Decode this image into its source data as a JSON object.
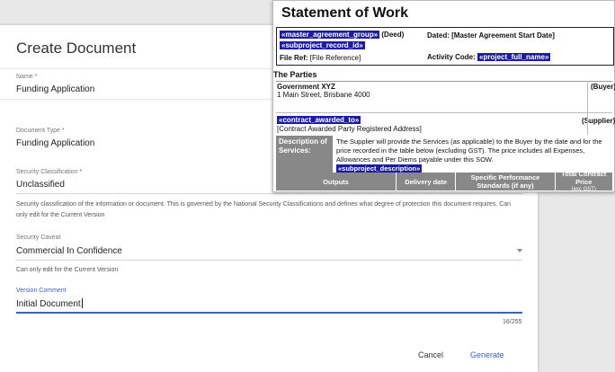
{
  "dialog": {
    "title": "Create Document",
    "name_label": "Name *",
    "name_value": "Funding Application",
    "doctype_label": "Document Type *",
    "doctype_value": "Funding Application",
    "security_label": "Security Classification *",
    "security_value": "Unclassified",
    "security_help_1": "Security classification of the information or document. This is governed by the National Security Classifications and defines what degree of protection this document requires. Can",
    "security_help_2": "only edit for the Current Version",
    "caveat_label": "Security Caveat",
    "caveat_value": "Commercial In Confidence",
    "caveat_help": "Can only edit for the Current Version",
    "comment_label": "Version Comment",
    "comment_value": "Initial Document",
    "counter": "16/255",
    "cancel_label": "Cancel",
    "generate_label": "Generate"
  },
  "sow": {
    "title": "Statement of Work",
    "master_group": "«master_agreement_group»",
    "deed": "(Deed)",
    "dated": "Dated: [Master Agreement Start Date]",
    "subproject_id": "«subproject_record_id»",
    "file_ref_label": "File Ref:",
    "file_ref_value": "[File Reference]",
    "activity_label": "Activity Code:",
    "activity_value": "«project_full_name»",
    "parties_title": "The Parties",
    "buyer_name": "Government XYZ",
    "buyer_address": "1 Main Street, Brisbane 4000",
    "buyer_role": "(Buyer)",
    "supplier_field": "«contract_awarded_to»",
    "supplier_address": "[Contract Awarded Party Registered Address]",
    "supplier_role": "(Supplier)",
    "desc_label": "Description of Services:",
    "desc_text": "The Supplier will provide the Services (as applicable) to the Buyer by the date and for the price recorded in the table below (excluding GST). The price includes all Expenses, Allowances and Per Diems payable under this SOW.",
    "desc_field": "«subproject_description»",
    "col_outputs": "Outputs",
    "col_delivery": "Delivery date",
    "col_standards": "Specific Performance Standards (if any)",
    "col_price": "Total Contract Price",
    "col_price_note": "(exc GST)"
  },
  "colors": {
    "accent": "#3e63b5",
    "merge_field_bg": "#1c1c9e",
    "header_gray": "#888888"
  }
}
